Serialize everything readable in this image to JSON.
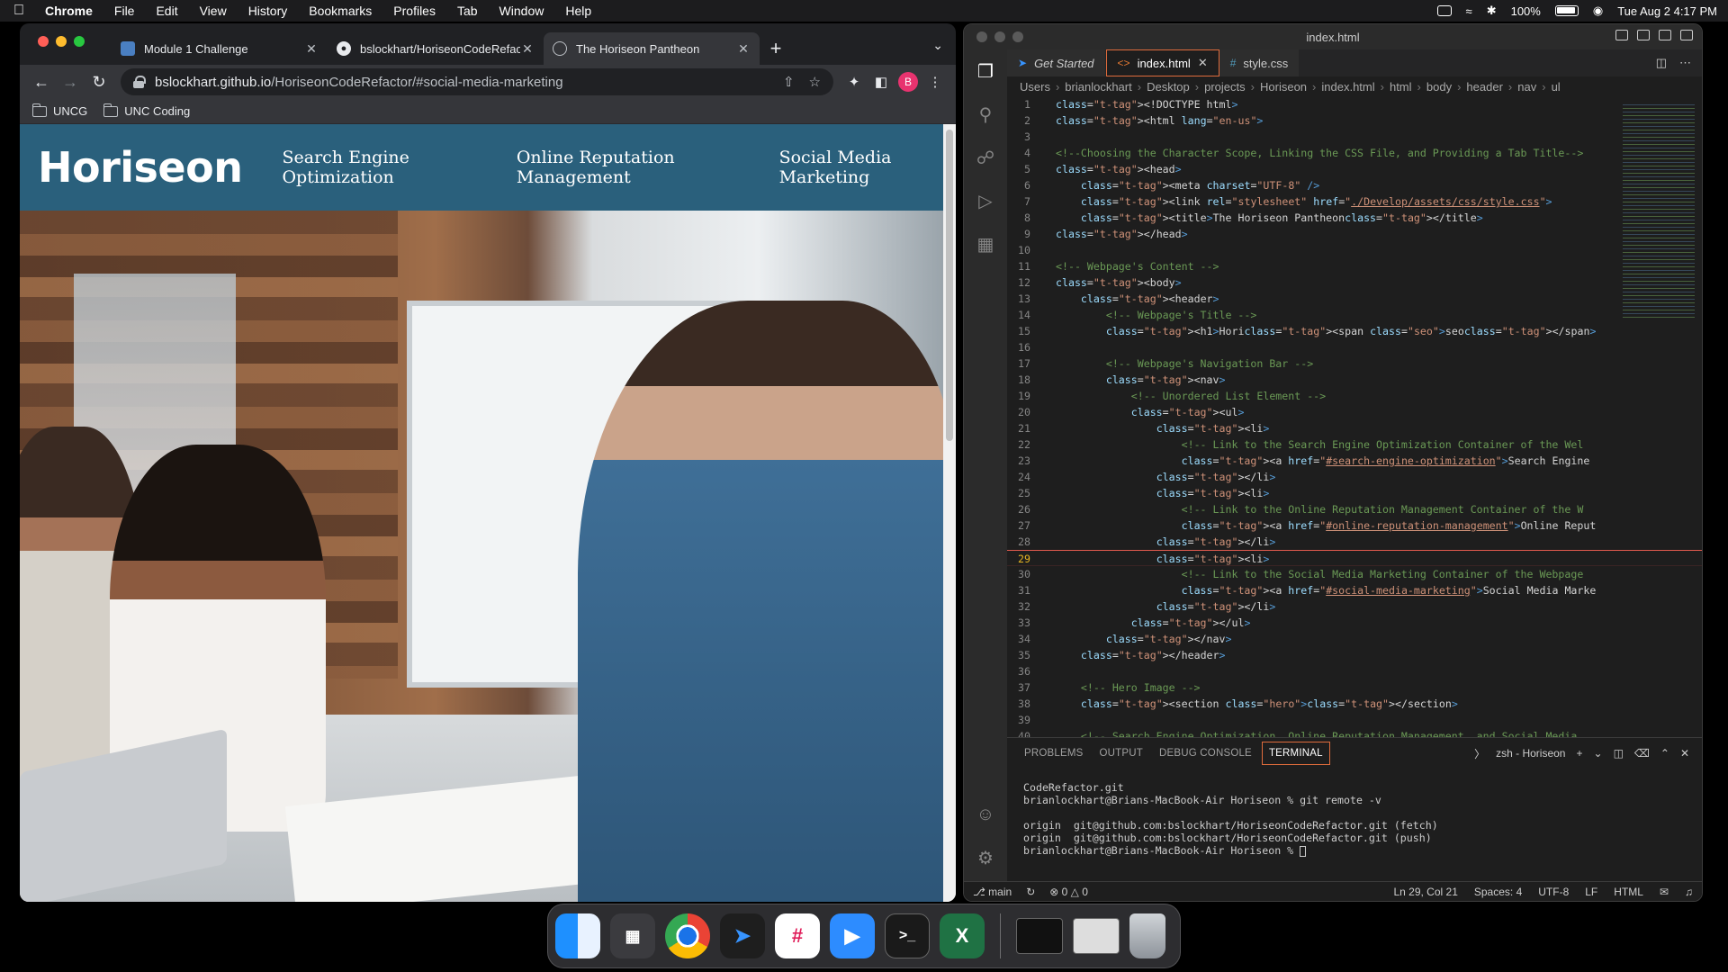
{
  "menubar": {
    "app": "Chrome",
    "items": [
      "File",
      "Edit",
      "View",
      "History",
      "Bookmarks",
      "Profiles",
      "Tab",
      "Window",
      "Help"
    ],
    "battery": "100%",
    "datetime": "Tue Aug 2  4:17 PM"
  },
  "chrome": {
    "tabs": [
      {
        "title": "Module 1 Challenge",
        "icon": "doc-icon"
      },
      {
        "title": "bslockhart/HoriseonCodeRefac",
        "icon": "github-icon"
      },
      {
        "title": "The Horiseon Pantheon",
        "icon": "globe-icon"
      }
    ],
    "url_host": "bslockhart.github.io",
    "url_path": "/HoriseonCodeRefactor/#social-media-marketing",
    "profile_initial": "B",
    "bookmarks": [
      "UNCG",
      "UNC Coding"
    ]
  },
  "site": {
    "logo": "Horiseon",
    "nav": [
      "Search Engine Optimization",
      "Online Reputation Management",
      "Social Media Marketing"
    ]
  },
  "vscode": {
    "window_title": "index.html",
    "tabs": [
      "Get Started",
      "index.html",
      "style.css"
    ],
    "breadcrumbs": [
      "Users",
      "brianlockhart",
      "Desktop",
      "projects",
      "Horiseon",
      "index.html",
      "html",
      "body",
      "header",
      "nav",
      "ul"
    ],
    "code_lines": [
      "<!DOCTYPE html>",
      "<html lang=\"en-us\">",
      "",
      "<!--Choosing the Character Scope, Linking the CSS File, and Providing a Tab Title-->",
      "<head>",
      "    <meta charset=\"UTF-8\" />",
      "    <link rel=\"stylesheet\" href=\"./Develop/assets/css/style.css\">",
      "    <title>The Horiseon Pantheon</title>",
      "</head>",
      "",
      "<!-- Webpage's Content -->",
      "<body>",
      "    <header>",
      "        <!-- Webpage's Title -->",
      "        <h1>Hori<span class=\"seo\">seo</span>n</h1>",
      "",
      "        <!-- Webpage's Navigation Bar -->",
      "        <nav>",
      "            <!-- Unordered List Element -->",
      "            <ul>",
      "                <li>",
      "                    <!-- Link to the Search Engine Optimization Container of the Wel",
      "                    <a href=\"#search-engine-optimization\">Search Engine Optimizatio",
      "                </li>",
      "                <li>",
      "                    <!-- Link to the Online Reputation Management Container of the W",
      "                    <a href=\"#online-reputation-management\">Online Reputation Manag",
      "                </li>",
      "                <li>",
      "                    <!-- Link to the Social Media Marketing Container of the Webpage",
      "                    <a href=\"#social-media-marketing\">Social Media Marketing</a>",
      "                </li>",
      "            </ul>",
      "        </nav>",
      "    </header>",
      "",
      "    <!-- Hero Image -->",
      "    <section class=\"hero\"></section>",
      "",
      "    <!-- Search Engine Optimization, Online Reputation Management, and Social Media"
    ],
    "current_line": 29,
    "panel_tabs": [
      "PROBLEMS",
      "OUTPUT",
      "DEBUG CONSOLE",
      "TERMINAL"
    ],
    "terminal_name": "zsh - Horiseon",
    "terminal_lines": [
      "CodeRefactor.git",
      "brianlockhart@Brians-MacBook-Air Horiseon % git remote -v",
      "",
      "origin  git@github.com:bslockhart/HoriseonCodeRefactor.git (fetch)",
      "origin  git@github.com:bslockhart/HoriseonCodeRefactor.git (push)",
      "brianlockhart@Brians-MacBook-Air Horiseon % "
    ],
    "status": {
      "branch": "main",
      "errors": "0",
      "warnings": "0",
      "position": "Ln 29, Col 21",
      "spaces": "Spaces: 4",
      "encoding": "UTF-8",
      "eol": "LF",
      "language": "HTML"
    }
  },
  "dock": [
    "finder-icon",
    "launchpad-icon",
    "chrome-icon",
    "vscode-icon",
    "slack-icon",
    "zoom-icon",
    "terminal-icon",
    "excel-icon"
  ]
}
